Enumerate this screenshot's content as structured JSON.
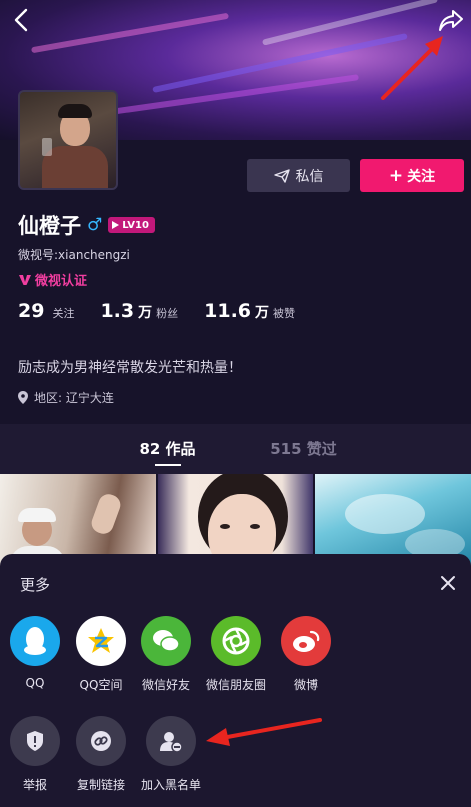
{
  "header": {
    "back_icon": "back-chevron-icon",
    "share_icon": "share-forward-icon"
  },
  "profile": {
    "name": "仙橙子",
    "gender_symbol": "♂",
    "level": "LV10",
    "weishi_id": "微视号:xianchengzi",
    "verified_label": "微视认证",
    "bio": "励志成为男神经常散发光芒和热量！",
    "location": "地区: 辽宁大连"
  },
  "actions": {
    "message_label": "私信",
    "follow_label": "关注",
    "follow_prefix": "+"
  },
  "stats": [
    {
      "num": "29",
      "unit": "",
      "label": "关注"
    },
    {
      "num": "1.3",
      "unit": "万",
      "label": "粉丝"
    },
    {
      "num": "11.6",
      "unit": "万",
      "label": "被赞"
    }
  ],
  "tabs": [
    {
      "count": "82",
      "label": "作品"
    },
    {
      "count": "515",
      "label": "赞过"
    }
  ],
  "sheet": {
    "title": "更多",
    "share_targets": [
      {
        "label": "QQ",
        "color": "#1aa8ec",
        "icon": "qq-penguin-icon"
      },
      {
        "label": "QQ空间",
        "color": "#ffffff",
        "icon": "qzone-star-icon"
      },
      {
        "label": "微信好友",
        "color": "#4bb63a",
        "icon": "wechat-icon"
      },
      {
        "label": "微信朋友圈",
        "color": "#5bbb2a",
        "icon": "moments-aperture-icon"
      },
      {
        "label": "微博",
        "color": "#e33b3b",
        "icon": "weibo-icon"
      }
    ],
    "more_actions": [
      {
        "label": "举报",
        "icon": "report-shield-icon"
      },
      {
        "label": "复制链接",
        "icon": "copy-link-icon"
      },
      {
        "label": "加入黑名单",
        "icon": "block-user-icon"
      }
    ]
  }
}
